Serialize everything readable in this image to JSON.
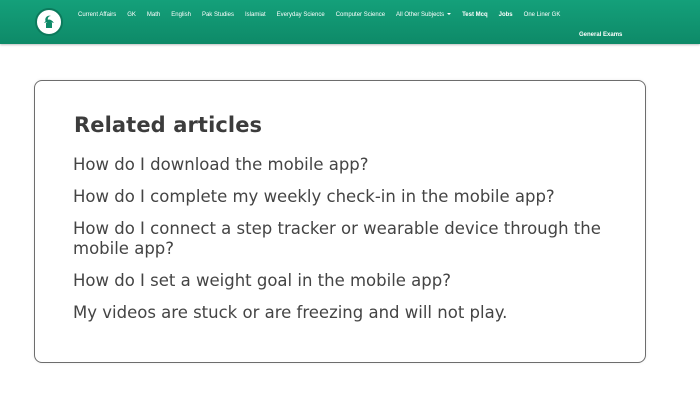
{
  "nav": {
    "items": [
      {
        "label": "Current Affairs",
        "bold": false
      },
      {
        "label": "GK",
        "bold": false
      },
      {
        "label": "Math",
        "bold": false
      },
      {
        "label": "English",
        "bold": false
      },
      {
        "label": "Pak Studies",
        "bold": false
      },
      {
        "label": "Islamiat",
        "bold": false
      },
      {
        "label": "Everyday Science",
        "bold": false
      },
      {
        "label": "Computer Science",
        "bold": false
      },
      {
        "label": "All Other Subjects",
        "bold": false,
        "dropdown": true
      },
      {
        "label": "Test Mcq",
        "bold": true
      },
      {
        "label": "Jobs",
        "bold": true
      },
      {
        "label": "One Liner GK",
        "bold": false
      }
    ],
    "second_row": "General Exams"
  },
  "colors": {
    "navbar": "#12976f",
    "card_border": "#6d6d6d",
    "text": "#444444"
  },
  "related": {
    "title": "Related articles",
    "articles": [
      "How do I download the mobile app?",
      "How do I complete my weekly check-in in the mobile app?",
      "How do I connect a step tracker or wearable device through the mobile app?",
      "How do I set a weight goal in the mobile app?",
      "My videos are stuck or are freezing and will not play."
    ]
  }
}
